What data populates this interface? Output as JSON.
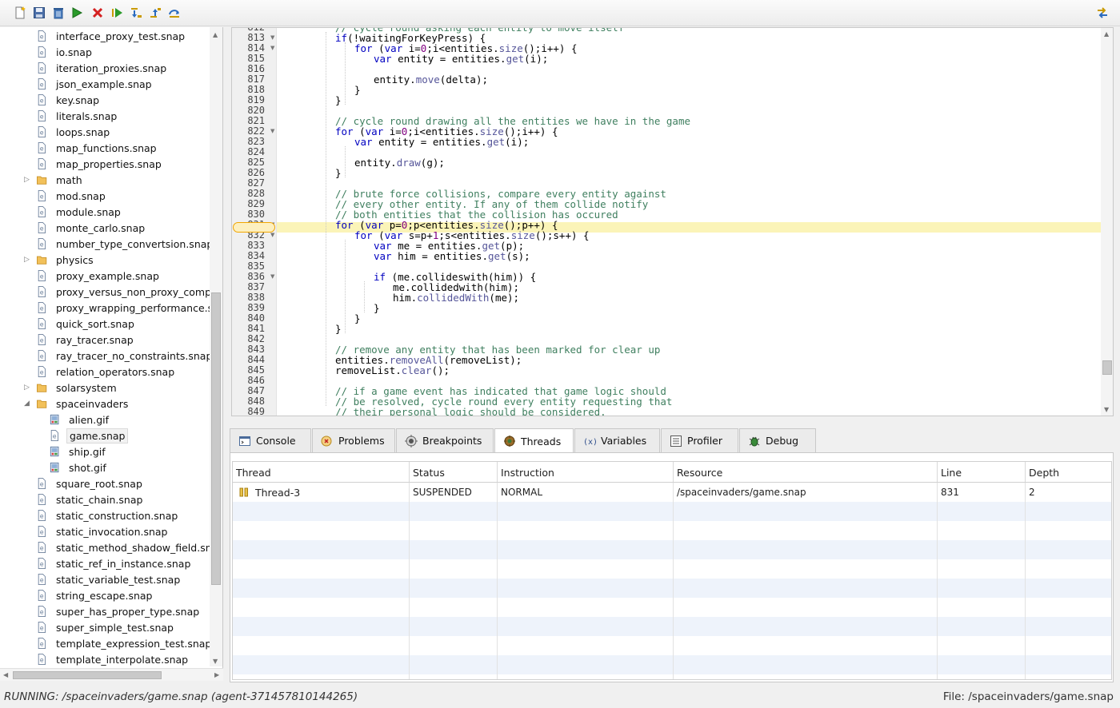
{
  "toolbar": {
    "icons": [
      "new-file-icon",
      "save-icon",
      "delete-icon",
      "run-icon",
      "stop-icon",
      "resume-icon",
      "step-into-icon",
      "step-out-icon",
      "step-over-icon",
      "swap-icon"
    ]
  },
  "tree": {
    "items": [
      {
        "label": "interface_proxy_test.snap",
        "type": "file"
      },
      {
        "label": "io.snap",
        "type": "file"
      },
      {
        "label": "iteration_proxies.snap",
        "type": "file"
      },
      {
        "label": "json_example.snap",
        "type": "file"
      },
      {
        "label": "key.snap",
        "type": "file"
      },
      {
        "label": "literals.snap",
        "type": "file"
      },
      {
        "label": "loops.snap",
        "type": "file"
      },
      {
        "label": "map_functions.snap",
        "type": "file"
      },
      {
        "label": "map_properties.snap",
        "type": "file"
      },
      {
        "label": "math",
        "type": "folder"
      },
      {
        "label": "mod.snap",
        "type": "file"
      },
      {
        "label": "module.snap",
        "type": "file"
      },
      {
        "label": "monte_carlo.snap",
        "type": "file"
      },
      {
        "label": "number_type_convertsion.snap",
        "type": "file"
      },
      {
        "label": "physics",
        "type": "folder"
      },
      {
        "label": "proxy_example.snap",
        "type": "file"
      },
      {
        "label": "proxy_versus_non_proxy_compar",
        "type": "file"
      },
      {
        "label": "proxy_wrapping_performance.sna",
        "type": "file"
      },
      {
        "label": "quick_sort.snap",
        "type": "file"
      },
      {
        "label": "ray_tracer.snap",
        "type": "file"
      },
      {
        "label": "ray_tracer_no_constraints.snap",
        "type": "file"
      },
      {
        "label": "relation_operators.snap",
        "type": "file"
      },
      {
        "label": "solarsystem",
        "type": "folder"
      },
      {
        "label": "spaceinvaders",
        "type": "folder-open"
      },
      {
        "label": "alien.gif",
        "type": "image"
      },
      {
        "label": "game.snap",
        "type": "file-selected"
      },
      {
        "label": "ship.gif",
        "type": "image"
      },
      {
        "label": "shot.gif",
        "type": "image"
      },
      {
        "label": "square_root.snap",
        "type": "file"
      },
      {
        "label": "static_chain.snap",
        "type": "file"
      },
      {
        "label": "static_construction.snap",
        "type": "file"
      },
      {
        "label": "static_invocation.snap",
        "type": "file"
      },
      {
        "label": "static_method_shadow_field.snap",
        "type": "file"
      },
      {
        "label": "static_ref_in_instance.snap",
        "type": "file"
      },
      {
        "label": "static_variable_test.snap",
        "type": "file"
      },
      {
        "label": "string_escape.snap",
        "type": "file"
      },
      {
        "label": "super_has_proper_type.snap",
        "type": "file"
      },
      {
        "label": "super_simple_test.snap",
        "type": "file"
      },
      {
        "label": "template_expression_test.snap",
        "type": "file"
      },
      {
        "label": "template_interpolate.snap",
        "type": "file"
      }
    ]
  },
  "editor": {
    "lines": [
      {
        "n": "812",
        "indent": 3,
        "tokens": [
          [
            "cm",
            "// cycle round asking each entity to move itself"
          ]
        ]
      },
      {
        "n": "813",
        "indent": 3,
        "fold": true,
        "tokens": [
          [
            "kw",
            "if"
          ],
          [
            "",
            "(!waitingForKeyPress) {"
          ]
        ]
      },
      {
        "n": "814",
        "indent": 4,
        "fold": true,
        "tokens": [
          [
            "kw",
            "for"
          ],
          [
            "",
            " ("
          ],
          [
            "kw",
            "var"
          ],
          [
            "",
            " i="
          ],
          [
            "num",
            "0"
          ],
          [
            "",
            ";i<entities."
          ],
          [
            "fn",
            "size"
          ],
          [
            "",
            "();i++) {"
          ]
        ]
      },
      {
        "n": "815",
        "indent": 5,
        "tokens": [
          [
            "kw",
            "var"
          ],
          [
            "",
            " entity = entities."
          ],
          [
            "fn",
            "get"
          ],
          [
            "",
            "(i);"
          ]
        ]
      },
      {
        "n": "816",
        "indent": 0,
        "tokens": []
      },
      {
        "n": "817",
        "indent": 5,
        "tokens": [
          [
            "",
            "entity."
          ],
          [
            "fn",
            "move"
          ],
          [
            "",
            "(delta);"
          ]
        ]
      },
      {
        "n": "818",
        "indent": 4,
        "tokens": [
          [
            "",
            "}"
          ]
        ]
      },
      {
        "n": "819",
        "indent": 3,
        "tokens": [
          [
            "",
            "}"
          ]
        ]
      },
      {
        "n": "820",
        "indent": 0,
        "tokens": []
      },
      {
        "n": "821",
        "indent": 3,
        "tokens": [
          [
            "cm",
            "// cycle round drawing all the entities we have in the game"
          ]
        ]
      },
      {
        "n": "822",
        "indent": 3,
        "fold": true,
        "tokens": [
          [
            "kw",
            "for"
          ],
          [
            "",
            " ("
          ],
          [
            "kw",
            "var"
          ],
          [
            "",
            " i="
          ],
          [
            "num",
            "0"
          ],
          [
            "",
            ";i<entities."
          ],
          [
            "fn",
            "size"
          ],
          [
            "",
            "();i++) {"
          ]
        ]
      },
      {
        "n": "823",
        "indent": 4,
        "tokens": [
          [
            "kw",
            "var"
          ],
          [
            "",
            " entity = entities."
          ],
          [
            "fn",
            "get"
          ],
          [
            "",
            "(i);"
          ]
        ]
      },
      {
        "n": "824",
        "indent": 0,
        "tokens": []
      },
      {
        "n": "825",
        "indent": 4,
        "tokens": [
          [
            "",
            "entity."
          ],
          [
            "fn",
            "draw"
          ],
          [
            "",
            "(g);"
          ]
        ]
      },
      {
        "n": "826",
        "indent": 3,
        "tokens": [
          [
            "",
            "}"
          ]
        ]
      },
      {
        "n": "827",
        "indent": 0,
        "tokens": []
      },
      {
        "n": "828",
        "indent": 3,
        "tokens": [
          [
            "cm",
            "// brute force collisions, compare every entity against"
          ]
        ]
      },
      {
        "n": "829",
        "indent": 3,
        "tokens": [
          [
            "cm",
            "// every other entity. If any of them collide notify"
          ]
        ]
      },
      {
        "n": "830",
        "indent": 3,
        "tokens": [
          [
            "cm",
            "// both entities that the collision has occured"
          ]
        ]
      },
      {
        "n": "831",
        "indent": 3,
        "fold": true,
        "current": true,
        "tokens": [
          [
            "kw",
            "for"
          ],
          [
            "",
            " ("
          ],
          [
            "kw",
            "var"
          ],
          [
            "",
            " p="
          ],
          [
            "num",
            "0"
          ],
          [
            "",
            ";p<entities."
          ],
          [
            "fn",
            "size"
          ],
          [
            "",
            "();p++) {"
          ]
        ]
      },
      {
        "n": "832",
        "indent": 4,
        "fold": true,
        "tokens": [
          [
            "kw",
            "for"
          ],
          [
            "",
            " ("
          ],
          [
            "kw",
            "var"
          ],
          [
            "",
            " s=p+"
          ],
          [
            "num",
            "1"
          ],
          [
            "",
            ";s<entities."
          ],
          [
            "fn",
            "size"
          ],
          [
            "",
            "();s++) {"
          ]
        ]
      },
      {
        "n": "833",
        "indent": 5,
        "tokens": [
          [
            "kw",
            "var"
          ],
          [
            "",
            " me = entities."
          ],
          [
            "fn",
            "get"
          ],
          [
            "",
            "(p);"
          ]
        ]
      },
      {
        "n": "834",
        "indent": 5,
        "tokens": [
          [
            "kw",
            "var"
          ],
          [
            "",
            " him = entities."
          ],
          [
            "fn",
            "get"
          ],
          [
            "",
            "(s);"
          ]
        ]
      },
      {
        "n": "835",
        "indent": 0,
        "tokens": []
      },
      {
        "n": "836",
        "indent": 5,
        "fold": true,
        "tokens": [
          [
            "kw",
            "if"
          ],
          [
            "",
            " (me.collideswith(him)) {"
          ]
        ]
      },
      {
        "n": "837",
        "indent": 6,
        "tokens": [
          [
            "",
            "me.collidedwith(him);"
          ]
        ]
      },
      {
        "n": "838",
        "indent": 6,
        "tokens": [
          [
            "",
            "him."
          ],
          [
            "fn",
            "collidedWith"
          ],
          [
            "",
            "(me);"
          ]
        ]
      },
      {
        "n": "839",
        "indent": 5,
        "tokens": [
          [
            "",
            "}"
          ]
        ]
      },
      {
        "n": "840",
        "indent": 4,
        "tokens": [
          [
            "",
            "}"
          ]
        ]
      },
      {
        "n": "841",
        "indent": 3,
        "tokens": [
          [
            "",
            "}"
          ]
        ]
      },
      {
        "n": "842",
        "indent": 0,
        "tokens": []
      },
      {
        "n": "843",
        "indent": 3,
        "tokens": [
          [
            "cm",
            "// remove any entity that has been marked for clear up"
          ]
        ]
      },
      {
        "n": "844",
        "indent": 3,
        "tokens": [
          [
            "",
            "entities."
          ],
          [
            "fn",
            "removeAll"
          ],
          [
            "",
            "(removeList);"
          ]
        ]
      },
      {
        "n": "845",
        "indent": 3,
        "tokens": [
          [
            "",
            "removeList."
          ],
          [
            "fn",
            "clear"
          ],
          [
            "",
            "();"
          ]
        ]
      },
      {
        "n": "846",
        "indent": 0,
        "tokens": []
      },
      {
        "n": "847",
        "indent": 3,
        "tokens": [
          [
            "cm",
            "// if a game event has indicated that game logic should"
          ]
        ]
      },
      {
        "n": "848",
        "indent": 3,
        "tokens": [
          [
            "cm",
            "// be resolved, cycle round every entity requesting that"
          ]
        ]
      },
      {
        "n": "849",
        "indent": 3,
        "tokens": [
          [
            "cm",
            "// their personal logic should be considered."
          ]
        ]
      }
    ]
  },
  "tabs": [
    {
      "label": "Console",
      "icon": "console-icon"
    },
    {
      "label": "Problems",
      "icon": "problems-icon"
    },
    {
      "label": "Breakpoints",
      "icon": "breakpoints-icon"
    },
    {
      "label": "Threads",
      "icon": "threads-icon",
      "active": true
    },
    {
      "label": "Variables",
      "icon": "variables-icon"
    },
    {
      "label": "Profiler",
      "icon": "profiler-icon"
    },
    {
      "label": "Debug",
      "icon": "debug-icon"
    }
  ],
  "threads_table": {
    "columns": [
      "Thread",
      "Status",
      "Instruction",
      "Resource",
      "Line",
      "Depth"
    ],
    "rows": [
      [
        "Thread-3",
        "SUSPENDED",
        "NORMAL",
        "/spaceinvaders/game.snap",
        "831",
        "2"
      ]
    ]
  },
  "status": {
    "left": "RUNNING: /spaceinvaders/game.snap (agent-371457810144265)",
    "right": "File: /spaceinvaders/game.snap"
  }
}
